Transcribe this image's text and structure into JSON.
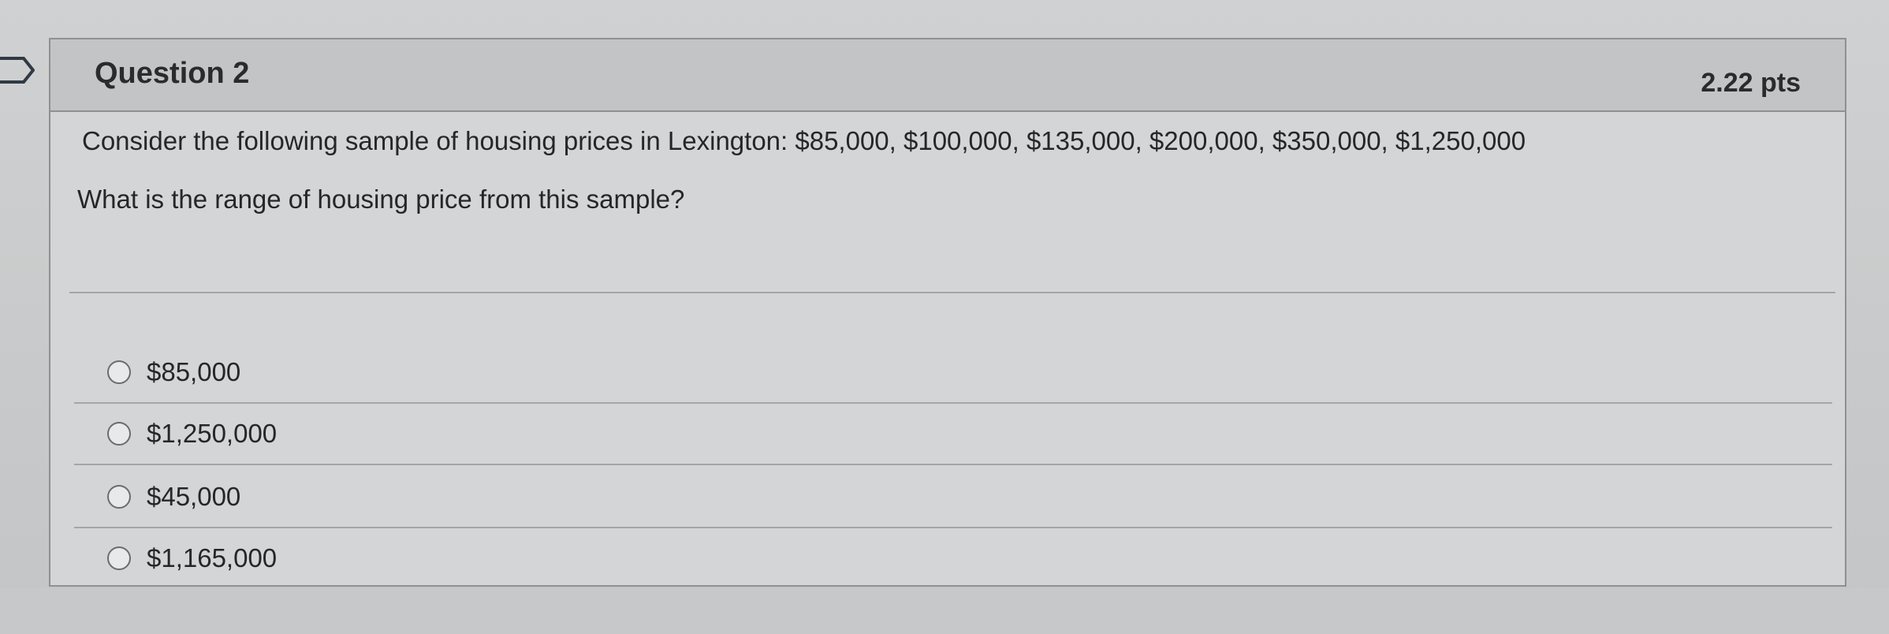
{
  "question": {
    "title": "Question 2",
    "points": "2.22 pts",
    "prompt": "Consider the following sample of housing prices in Lexington: $85,000, $100,000, $135,000, $200,000, $350,000, $1,250,000",
    "question_text": "What is the range of housing price from this sample?",
    "answers": [
      {
        "label": "$85,000",
        "selected": false
      },
      {
        "label": "$1,250,000",
        "selected": false
      },
      {
        "label": "$45,000",
        "selected": false
      },
      {
        "label": "$1,165,000",
        "selected": false
      }
    ]
  },
  "colors": {
    "background": "#c9cbcc",
    "header_bg": "#c2c4c5",
    "border": "#8e9091",
    "text": "#262626"
  },
  "icons": {
    "flag": "bookmark-flag-icon",
    "radio": "radio-button-icon"
  }
}
